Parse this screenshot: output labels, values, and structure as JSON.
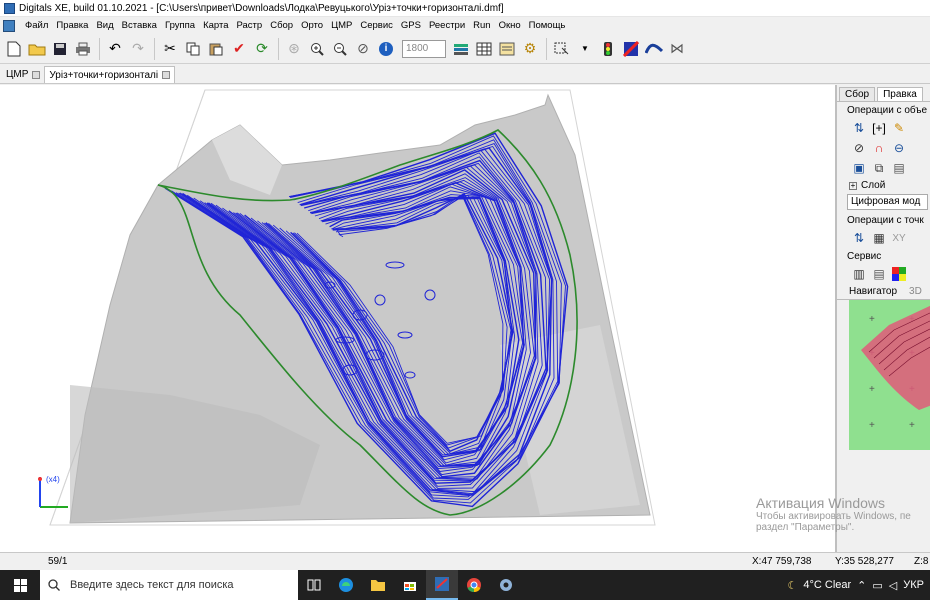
{
  "window": {
    "title": "Digitals XE, build 01.10.2021 - [C:\\Users\\привет\\Downloads\\Лодка\\Ревуцького\\Урiз+точки+горизонталi.dmf]"
  },
  "menu": [
    "Файл",
    "Правка",
    "Вид",
    "Вставка",
    "Группа",
    "Карта",
    "Растр",
    "Сбор",
    "Орто",
    "ЦМР",
    "Сервис",
    "GPS",
    "Реестри",
    "Run",
    "Окно",
    "Помощь"
  ],
  "toolbar": {
    "scale_value": "1800"
  },
  "doc_tabs": [
    {
      "label": "ЦМР",
      "active": false
    },
    {
      "label": "Урiз+точки+горизонталi",
      "active": true
    }
  ],
  "viewport": {
    "axes_label": "(x4)",
    "colors": {
      "terrain": "#c9c9c9",
      "contour": "#1f24d6",
      "boundary": "#2c8a2c",
      "frame": "#d4d4d4"
    }
  },
  "right_panel": {
    "tabs": [
      "Сбор",
      "Правка"
    ],
    "active_tab": "Правка",
    "sections": {
      "object_ops": "Операции с объе",
      "layer": "Слой",
      "layer_value": "Цифровая мод",
      "point_ops": "Операции с точк",
      "xy_label": "XY",
      "service": "Сервис",
      "navigator": "Навигатор",
      "navigator_3d": "3D"
    },
    "navmap_color": "#8fe08f"
  },
  "watermark": {
    "title": "Активация Windows",
    "line1": "Чтобы активировать Windows, пе",
    "line2": "раздел \"Параметры\"."
  },
  "status": {
    "page": "59/1",
    "x": "X:47 759,738",
    "y": "Y:35 528,277",
    "z": "Z:8"
  },
  "taskbar": {
    "search_placeholder": "Введите здесь текст для поиска",
    "weather": "4°C  Clear",
    "lang": "УКР"
  }
}
